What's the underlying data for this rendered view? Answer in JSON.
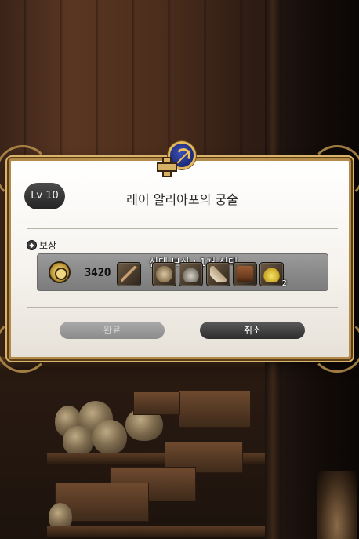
{
  "quest": {
    "level": "Lv 10",
    "title": "레이 알리아포의 궁술"
  },
  "rewards": {
    "label": "보상",
    "gil_amount": "3420",
    "select_hint": "선택 보상 : 1개 선택",
    "items": [
      {
        "icon": "bow-icon",
        "qty": ""
      },
      {
        "icon": "armor-vest-icon",
        "qty": ""
      },
      {
        "icon": "helmet-icon",
        "qty": ""
      },
      {
        "icon": "gloves-icon",
        "qty": ""
      },
      {
        "icon": "boots-icon",
        "qty": ""
      },
      {
        "icon": "potion-icon",
        "qty": "2"
      }
    ]
  },
  "buttons": {
    "complete": "완료",
    "cancel": "취소"
  },
  "colors": {
    "frame_gold": "#b48a4a",
    "emblem_blue": "#1d2a78",
    "reward_bar": "#8a8a8a"
  }
}
